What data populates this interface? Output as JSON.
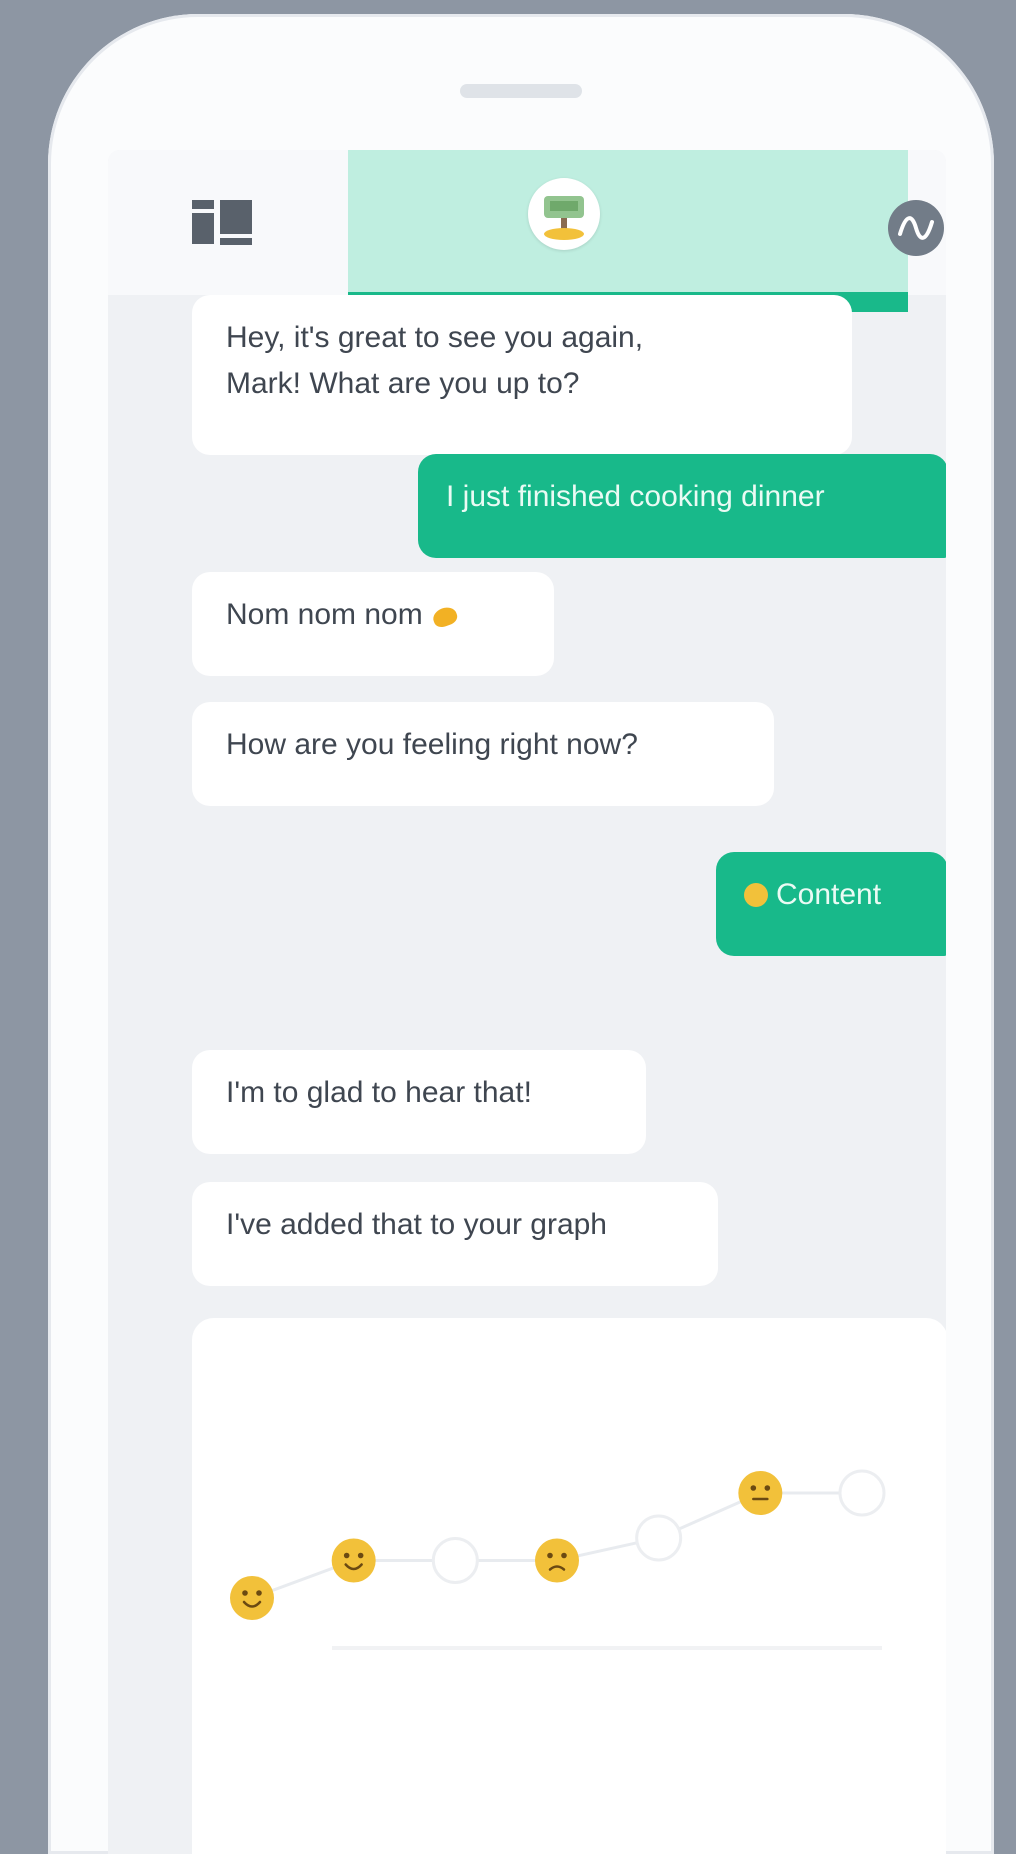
{
  "header": {
    "menu_icon": "menu-grid-icon",
    "active_tab_icon": "chat-avatar-icon",
    "graph_tab_icon": "mood-graph-icon"
  },
  "messages": [
    {
      "sender": "bot",
      "text": "Hey, it's great to see you again, Mark! What are you up to?",
      "lines": [
        "Hey, it's great to see you again,",
        "Mark! What are you up to?"
      ]
    },
    {
      "sender": "user",
      "text": "I just finished cooking dinner"
    },
    {
      "sender": "bot",
      "text": "Nom nom nom",
      "icon": "food-emoji-icon"
    },
    {
      "sender": "bot",
      "text": "How are you feeling right now?"
    },
    {
      "sender": "user",
      "text": "Content",
      "icon": "content-emoji-icon"
    },
    {
      "sender": "bot",
      "text": "I'm to glad to hear that!"
    },
    {
      "sender": "bot",
      "text": "I've added that to your graph"
    }
  ],
  "mood_graph": {
    "points": [
      {
        "mood": "smiling",
        "level": 0.3
      },
      {
        "mood": "smiling",
        "level": 0.55
      },
      {
        "mood": "empty",
        "level": 0.55
      },
      {
        "mood": "worried",
        "level": 0.55
      },
      {
        "mood": "empty",
        "level": 0.7
      },
      {
        "mood": "content",
        "level": 1.0
      },
      {
        "mood": "empty",
        "level": 1.0
      }
    ],
    "colors": {
      "emoji": "#f2c13a",
      "line": "#e8ebef",
      "accent": "#18b98a"
    }
  }
}
